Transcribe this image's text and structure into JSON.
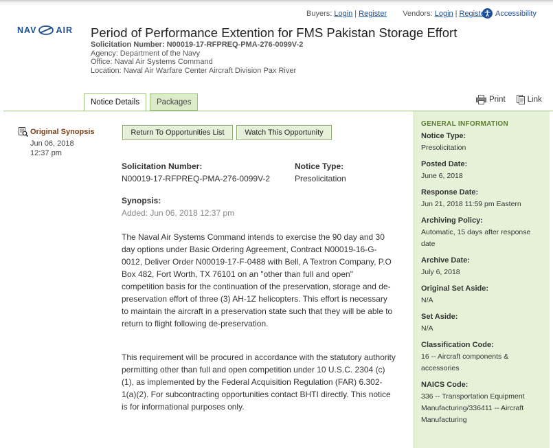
{
  "header": {
    "buyers_label": "Buyers:",
    "buyers_login": "Login",
    "buyers_register": "Register",
    "vendors_label": "Vendors:",
    "vendors_login": "Login",
    "vendors_register": "Register",
    "accessibility": "Accessibility",
    "logo_left": "NAV",
    "logo_right": "AIR"
  },
  "notice": {
    "title": "Period of Performance Extention for FMS Pakistan Storage Effort",
    "solicitation_line": "Solicitation Number: N00019-17-RFPREQ-PMA-276-0099V-2",
    "agency": "Agency: Department of the Navy",
    "office": "Office: Naval Air Systems Command",
    "location": "Location: Naval Air Warfare Center Aircraft Division Pax River"
  },
  "tabs": [
    {
      "label": "Notice Details"
    },
    {
      "label": "Packages"
    }
  ],
  "utility": {
    "print": "Print",
    "link": "Link"
  },
  "side": {
    "synopsis_link": "Original Synopsis",
    "date": "Jun 06, 2018",
    "time": "12:37 pm"
  },
  "buttons": {
    "return": "Return To Opportunities List",
    "watch": "Watch This Opportunity"
  },
  "main": {
    "sol_label": "Solicitation Number:",
    "sol_value": "N00019-17-RFPREQ-PMA-276-0099V-2",
    "type_label": "Notice Type:",
    "type_value": "Presolicitation",
    "synopsis_label": "Synopsis:",
    "added": "Added: Jun 06, 2018 12:37 pm",
    "para1": "The Naval Air Systems Command intends to exercise the 90 day and 30 day options under Basic Ordering Agreement, Contract N00019-16-G-0012, Deliver Order N00019-17-F-0488 with Bell, A Textron Company, P.O Box 482, Fort Worth, TX 76101 on an \"other than full and open\" competition basis for the continuation of the preservation, storage and de-preservation effort of three (3) AH-1Z helicopters.  This effort is necessary to maintain the aircraft in a preservation state such that they will be able to return to flight following de-preservation.",
    "para2": "This requirement will be procured in accordance with the statutory authority permitting other than full and open competition under 10 U.S.C. 2304 (c)(1), as implemented by the Federal Acquisition Regulation (FAR) 6.302-1(a)(2). For subcontracting opportunities contact BHTI directly.  This notice is for informational purposes only."
  },
  "general": {
    "heading": "GENERAL INFORMATION",
    "items": [
      {
        "key": "Notice Type:",
        "value": "Presolicitation"
      },
      {
        "key": "Posted Date:",
        "value": "June 6, 2018"
      },
      {
        "key": "Response Date:",
        "value": "Jun 21, 2018 11:59 pm Eastern"
      },
      {
        "key": "Archiving Policy:",
        "value": "Automatic, 15 days after response date"
      },
      {
        "key": "Archive Date:",
        "value": "July 6, 2018"
      },
      {
        "key": "Original Set Aside:",
        "value": "N/A"
      },
      {
        "key": "Set Aside:",
        "value": "N/A"
      },
      {
        "key": "Classification Code:",
        "value": "16 -- Aircraft components & accessories"
      },
      {
        "key": "NAICS Code:",
        "value": "336 -- Transportation Equipment Manufacturing/336411 -- Aircraft Manufacturing"
      }
    ]
  }
}
